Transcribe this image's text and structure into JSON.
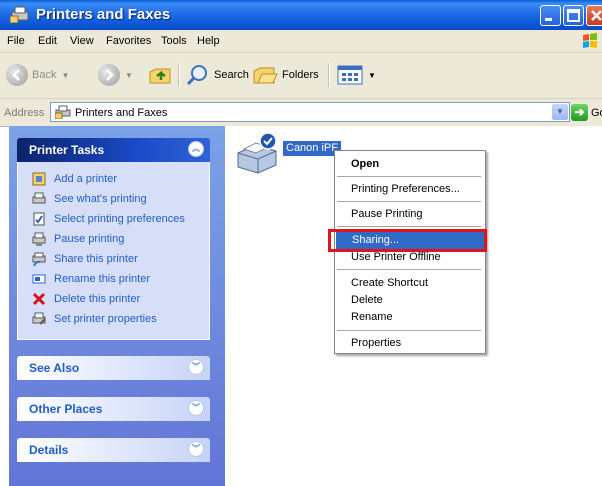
{
  "window": {
    "title": "Printers and Faxes"
  },
  "menu": [
    "File",
    "Edit",
    "View",
    "Favorites",
    "Tools",
    "Help"
  ],
  "toolbar": {
    "back_label": "Back",
    "search_label": "Search",
    "folders_label": "Folders"
  },
  "address": {
    "label": "Address",
    "value": "Printers and Faxes",
    "go_label": "Go"
  },
  "left_pane": {
    "printer_tasks": {
      "title": "Printer Tasks",
      "items": [
        {
          "label": "Add a printer",
          "icon": "add-printer-icon"
        },
        {
          "label": "See what's printing",
          "icon": "print-queue-icon"
        },
        {
          "label": "Select printing preferences",
          "icon": "preferences-icon"
        },
        {
          "label": "Pause printing",
          "icon": "pause-printer-icon"
        },
        {
          "label": "Share this printer",
          "icon": "share-printer-icon"
        },
        {
          "label": "Rename this printer",
          "icon": "rename-icon"
        },
        {
          "label": "Delete this printer",
          "icon": "delete-icon"
        },
        {
          "label": "Set printer properties",
          "icon": "properties-icon"
        }
      ]
    },
    "see_also": {
      "title": "See Also"
    },
    "other_places": {
      "title": "Other Places"
    },
    "details": {
      "title": "Details"
    }
  },
  "printer": {
    "label": "Canon iPF"
  },
  "context_menu": {
    "items": [
      "Open",
      "Printing Preferences...",
      "Pause Printing",
      "Sharing...",
      "Use Printer Offline",
      "Create Shortcut",
      "Delete",
      "Rename",
      "Properties"
    ],
    "highlighted": "Sharing..."
  },
  "colors": {
    "title_bar": "#0c57d6",
    "selection": "#316ac5",
    "task_link": "#215dc6",
    "highlight_box": "#e0141b"
  }
}
